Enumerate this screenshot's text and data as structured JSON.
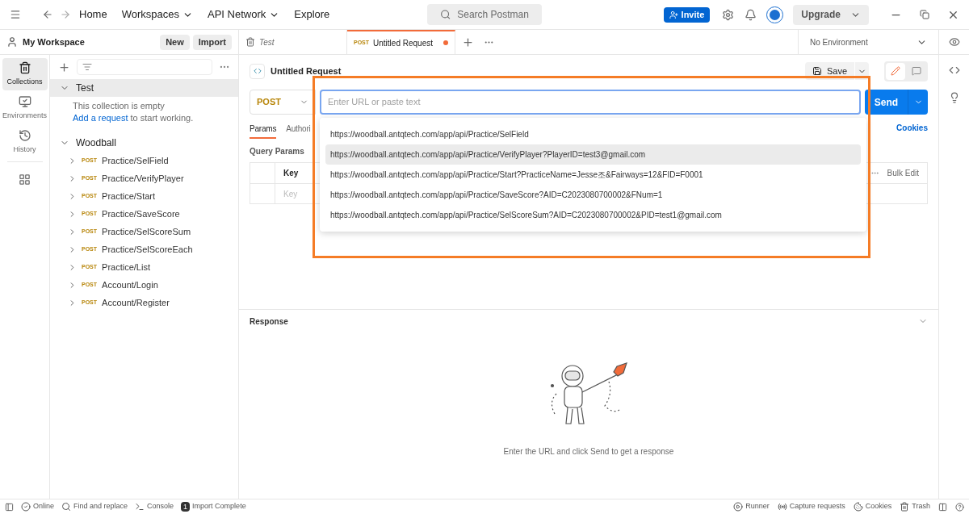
{
  "top_bar": {
    "nav": [
      {
        "label": "Home",
        "dropdown": false
      },
      {
        "label": "Workspaces",
        "dropdown": true
      },
      {
        "label": "API Network",
        "dropdown": true
      },
      {
        "label": "Explore",
        "dropdown": false
      }
    ],
    "search": {
      "placeholder": "Search Postman"
    },
    "invite": "Invite",
    "upgrade": "Upgrade"
  },
  "workspace": {
    "title": "My Workspace",
    "buttons": [
      "New",
      "Import"
    ]
  },
  "rail": [
    {
      "label": "Collections",
      "selected": true
    },
    {
      "label": "Environments",
      "selected": false
    },
    {
      "label": "History",
      "selected": false
    }
  ],
  "tabs": [
    {
      "label": "Test",
      "selected": false,
      "unsaved": false
    },
    {
      "label": "Untitled Request",
      "method": "POST",
      "selected": true,
      "unsaved": true
    }
  ],
  "environment": "No Environment",
  "collections": [
    {
      "name": "Test",
      "expanded": true,
      "selected": true,
      "empty_text": "This collection is empty",
      "empty_link": "Add a request",
      "empty_rest": " to start working."
    },
    {
      "name": "Woodball",
      "expanded": true,
      "selected": false,
      "children": [
        {
          "method": "POST",
          "name": "Practice/SelField"
        },
        {
          "method": "POST",
          "name": "Practice/VerifyPlayer"
        },
        {
          "method": "POST",
          "name": "Practice/Start"
        },
        {
          "method": "POST",
          "name": "Practice/SaveScore"
        },
        {
          "method": "POST",
          "name": "Practice/SelScoreSum"
        },
        {
          "method": "POST",
          "name": "Practice/SelScoreEach"
        },
        {
          "method": "POST",
          "name": "Practice/List"
        },
        {
          "method": "POST",
          "name": "Account/Login"
        },
        {
          "method": "POST",
          "name": "Account/Register"
        }
      ]
    }
  ],
  "request": {
    "title": "Untitled Request",
    "save": "Save",
    "method": "POST",
    "url_placeholder": "Enter URL or paste text",
    "send": "Send",
    "tabs": [
      {
        "label": "Params",
        "selected": true
      },
      {
        "label": "Authori",
        "selected": false
      }
    ],
    "cookies": "Cookies",
    "query_title": "Query Params",
    "key_header": "Key",
    "key_placeholder": "Key",
    "bulk_edit": "Bulk Edit"
  },
  "suggestions": [
    {
      "url": "https://woodball.antqtech.com/app/api/Practice/SelField",
      "selected": false
    },
    {
      "url": "https://woodball.antqtech.com/app/api/Practice/VerifyPlayer?PlayerID=test3@gmail.com",
      "selected": true
    },
    {
      "url": "https://woodball.antqtech.com/app/api/Practice/Start?PracticeName=Jesse조&Fairways=12&FID=F0001",
      "selected": false
    },
    {
      "url": "https://woodball.antqtech.com/app/api/Practice/SaveScore?AID=C2023080700002&FNum=1",
      "selected": false
    },
    {
      "url": "https://woodball.antqtech.com/app/api/Practice/SelScoreSum?AID=C2023080700002&PID=test1@gmail.com",
      "selected": false
    }
  ],
  "response": {
    "title": "Response",
    "hint": "Enter the URL and click Send to get a response"
  },
  "status_bar": {
    "left": [
      {
        "kind": "online",
        "label": "Online"
      },
      {
        "kind": "find",
        "label": "Find and replace"
      },
      {
        "kind": "console",
        "label": "Console"
      },
      {
        "kind": "import",
        "label": "Import Complete",
        "badge": "1"
      }
    ],
    "right": [
      {
        "kind": "runner",
        "label": "Runner"
      },
      {
        "kind": "capture",
        "label": "Capture requests"
      },
      {
        "kind": "cookies",
        "label": "Cookies"
      },
      {
        "kind": "trash",
        "label": "Trash"
      }
    ]
  }
}
